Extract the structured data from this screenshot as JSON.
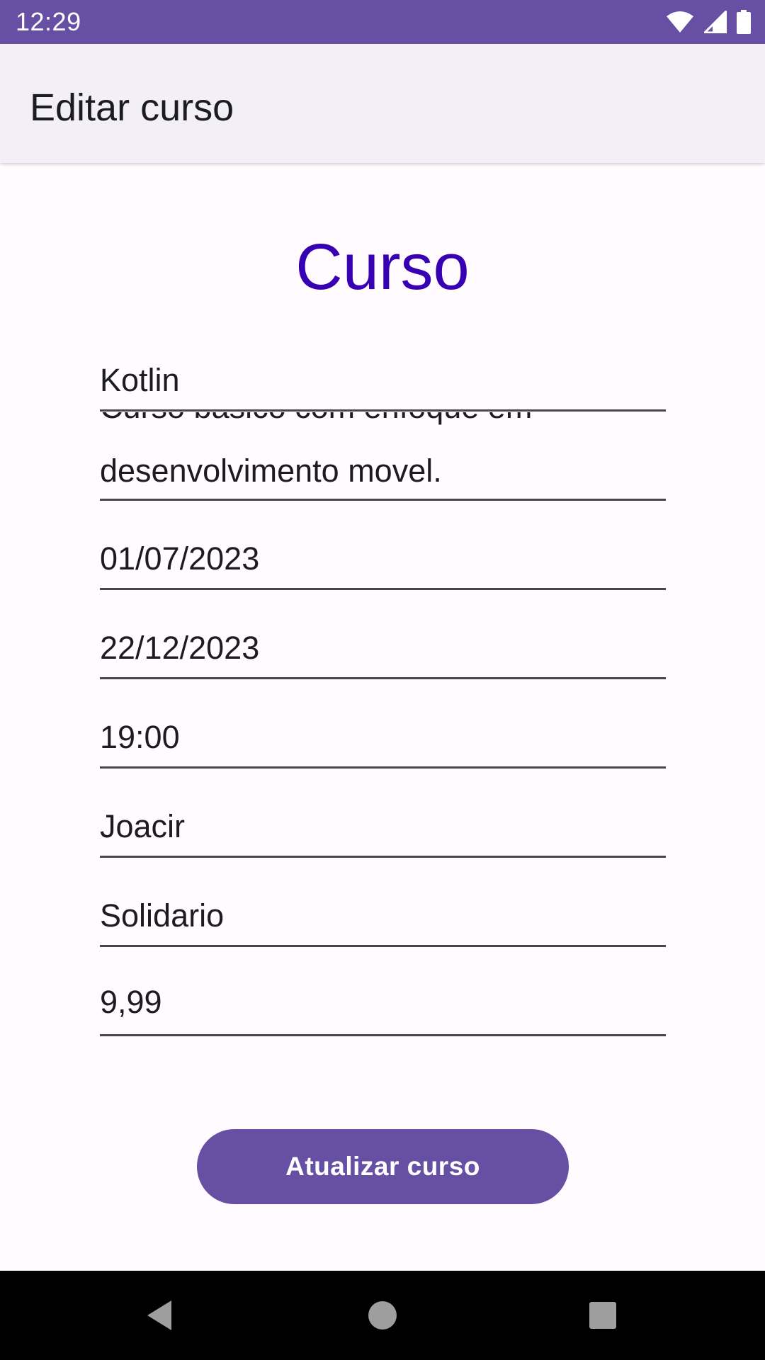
{
  "status_bar": {
    "time": "12:29",
    "icons": [
      "wifi-icon",
      "cellular-signal-icon",
      "battery-icon"
    ]
  },
  "app_bar": {
    "title": "Editar curso"
  },
  "form": {
    "heading": "Curso",
    "fields": [
      {
        "name": "nome",
        "value": "Kotlin"
      },
      {
        "name": "descricao",
        "value_line1": "Curso basico com enfoque em",
        "value_line2": "desenvolvimento movel."
      },
      {
        "name": "data-inicio",
        "value": "01/07/2023"
      },
      {
        "name": "data-fim",
        "value": "22/12/2023"
      },
      {
        "name": "horario",
        "value": "19:00"
      },
      {
        "name": "professor",
        "value": "Joacir"
      },
      {
        "name": "tipo",
        "value": "Solidario"
      },
      {
        "name": "valor",
        "value": "9,99"
      }
    ],
    "submit_label": "Atualizar curso"
  },
  "nav_bar": {
    "icons": [
      "back-icon",
      "home-icon",
      "recents-icon"
    ]
  },
  "colors": {
    "primary": "#6750A4",
    "heading": "#3700B3",
    "app_bar_bg": "#F3EFF7",
    "background": "#FFFBFE",
    "underline": "#49454F"
  }
}
